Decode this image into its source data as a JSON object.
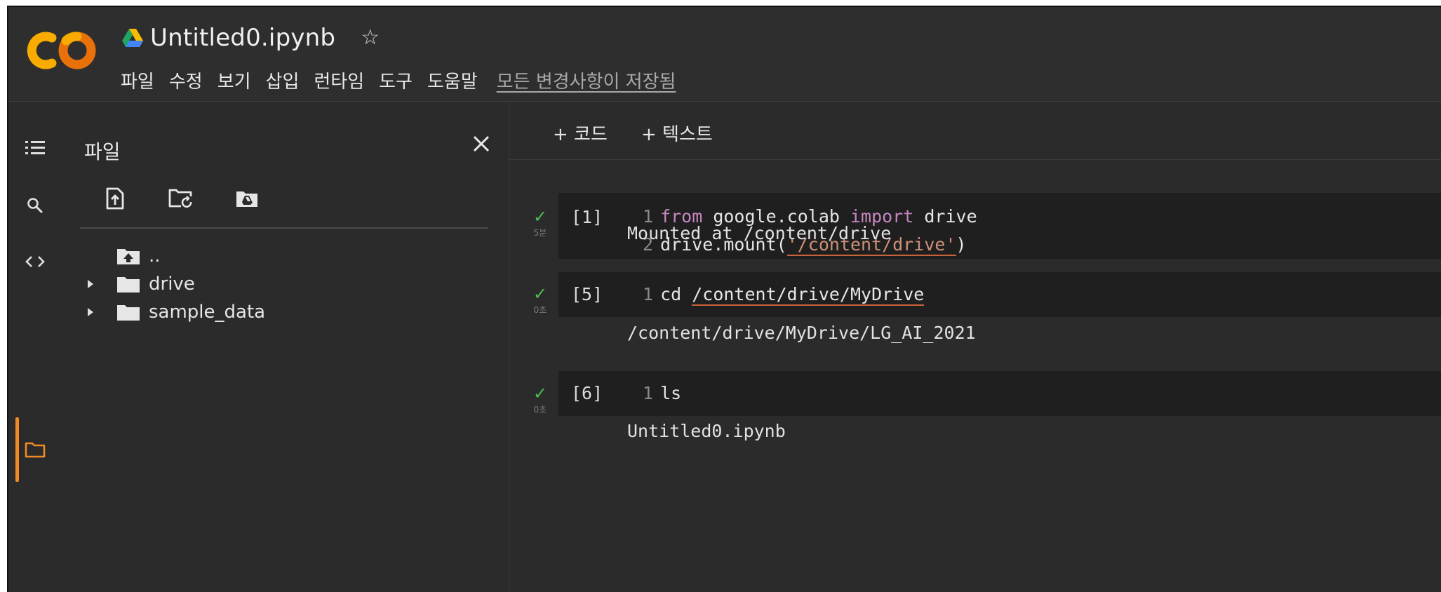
{
  "header": {
    "doc_title": "Untitled0.ipynb",
    "menu": [
      "파일",
      "수정",
      "보기",
      "삽입",
      "런타임",
      "도구",
      "도움말"
    ],
    "save_status": "모든 변경사항이 저장됨"
  },
  "sidebar": {
    "title": "파일",
    "tree": [
      {
        "label": ".."
      },
      {
        "label": "drive"
      },
      {
        "label": "sample_data"
      }
    ]
  },
  "toolbar": {
    "add_code": "+ 코드",
    "add_text": "+ 텍스트"
  },
  "cells": [
    {
      "prompt": "[1]",
      "elapsed": "5분",
      "lines": [
        {
          "num": "1",
          "t1": "from",
          "t2": " google.colab ",
          "t3": "import",
          "t4": " drive"
        },
        {
          "num": "2",
          "t1": "drive.mount(",
          "t2": "'/content/drive'",
          "t3": ")"
        }
      ],
      "output": "Mounted at /content/drive"
    },
    {
      "prompt": "[5]",
      "elapsed": "0초",
      "lines": [
        {
          "num": "1",
          "t1": "cd ",
          "t2": "/content/drive/MyDrive"
        }
      ],
      "output": "/content/drive/MyDrive/LG_AI_2021"
    },
    {
      "prompt": "[6]",
      "elapsed": "0초",
      "lines": [
        {
          "num": "1",
          "t1": "ls"
        }
      ],
      "output": "Untitled0.ipynb"
    }
  ],
  "colors": {
    "background": "#2b2b2b",
    "cell_background": "#1f1f1f",
    "accent_orange": "#f08a24",
    "logo_yellow": "#f9ab00",
    "logo_orange": "#e8710a",
    "keyword": "#c586c0",
    "string": "#ce9178",
    "success_green": "#4cbf50"
  },
  "icons": [
    "colab-logo",
    "google-drive-icon",
    "star-icon",
    "toc-icon",
    "search-icon",
    "code-snippets-icon",
    "folder-icon",
    "close-icon",
    "upload-file-icon",
    "refresh-folder-icon",
    "mount-drive-icon",
    "folder-up-icon",
    "caret-right-icon",
    "check-icon"
  ]
}
